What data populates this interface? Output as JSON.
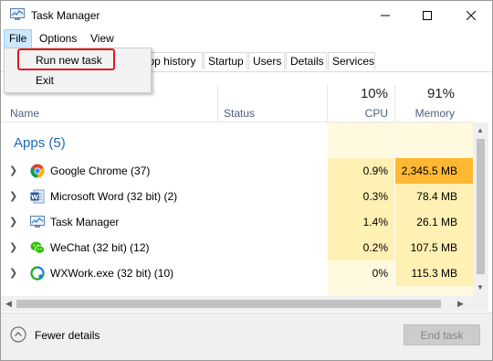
{
  "window": {
    "title": "Task Manager"
  },
  "menu": {
    "file": "File",
    "options": "Options",
    "view": "View"
  },
  "file_menu": {
    "items": [
      "Run new task",
      "Exit"
    ]
  },
  "tabs": [
    "pp history",
    "Startup",
    "Users",
    "Details",
    "Services"
  ],
  "columns": {
    "name": "Name",
    "status": "Status",
    "cpu_label": "CPU",
    "cpu_percent": "10%",
    "memory_label": "Memory",
    "memory_percent": "91%"
  },
  "group": {
    "title": "Apps (5)"
  },
  "rows": [
    {
      "name": "Google Chrome (37)",
      "icon": "chrome-icon",
      "cpu": "0.9%",
      "memory": "2,345.5 MB"
    },
    {
      "name": "Microsoft Word (32 bit) (2)",
      "icon": "word-icon",
      "cpu": "0.3%",
      "memory": "78.4 MB"
    },
    {
      "name": "Task Manager",
      "icon": "task-manager-icon",
      "cpu": "1.4%",
      "memory": "26.1 MB"
    },
    {
      "name": "WeChat (32 bit) (12)",
      "icon": "wechat-icon",
      "cpu": "0.2%",
      "memory": "107.5 MB"
    },
    {
      "name": "WXWork.exe (32 bit) (10)",
      "icon": "wxwork-icon",
      "cpu": "0%",
      "memory": "115.3 MB"
    }
  ],
  "footer": {
    "fewer_details": "Fewer details",
    "end_task": "End task"
  },
  "colors": {
    "heat_light": "#fff9e0",
    "heat_medium": "#fff0b3",
    "heat_high": "#ffd27a",
    "heat_max": "#ffb833",
    "group_title": "#1e6ab5",
    "highlight": "#e0191e"
  }
}
